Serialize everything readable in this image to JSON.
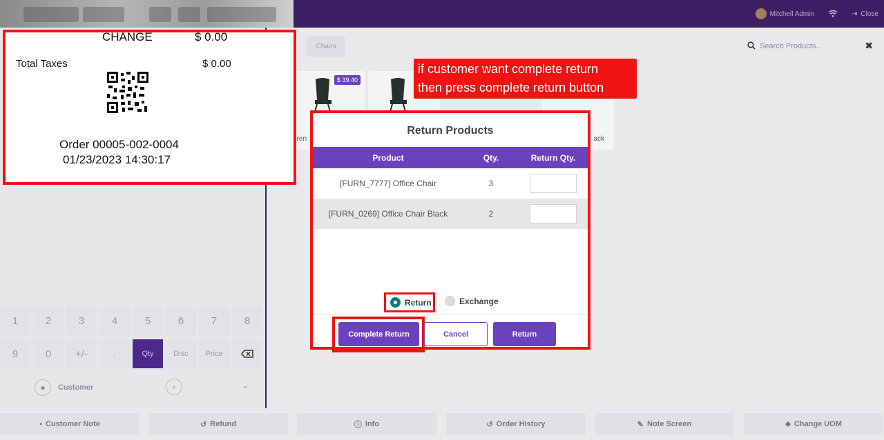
{
  "topbar": {
    "user_name": "Mitchell Admin",
    "close_label": "Close"
  },
  "products": {
    "category": "Chairs",
    "search_placeholder": "Search Products...",
    "cards": [
      {
        "price": "$ 39.40",
        "name": "eren"
      },
      {
        "price": "",
        "name": ""
      },
      {
        "price": "",
        "name": ""
      },
      {
        "price": "",
        "name": "ack"
      }
    ]
  },
  "receipt": {
    "change_label": "CHANGE",
    "change_value": "$ 0.00",
    "taxes_label": "Total Taxes",
    "taxes_value": "$ 0.00",
    "order_ref": "Order 00005-002-0004",
    "order_datetime": "01/23/2023 14:30:17"
  },
  "annotation": {
    "line1": "if  customer want complete return",
    "line2": "then press complete return button"
  },
  "modal": {
    "title": "Return Products",
    "columns": [
      "Product",
      "Qty.",
      "Return Qty."
    ],
    "rows": [
      {
        "product": "[FURN_7777] Office Chair",
        "qty": "3",
        "return_qty": ""
      },
      {
        "product": "[FURN_0269] Office Chair Black",
        "qty": "2",
        "return_qty": ""
      }
    ],
    "radio_return": "Return",
    "radio_exchange": "Exchange",
    "complete_return_label": "Complete Return",
    "cancel_label": "Cancel",
    "return_label": "Return"
  },
  "numpad": {
    "row1": [
      "1",
      "2",
      "3",
      "4",
      "5",
      "6",
      "7",
      "8"
    ],
    "row2": [
      "9",
      "0",
      "+/-",
      ".",
      "Qty",
      "Disc",
      "Price"
    ],
    "customer_label": "Customer"
  },
  "bottom_bar": [
    {
      "label": "Customer Note",
      "icon": "note-icon"
    },
    {
      "label": "Refund",
      "icon": "undo-icon"
    },
    {
      "label": "Info",
      "icon": "info-icon"
    },
    {
      "label": "Order History",
      "icon": "history-icon"
    },
    {
      "label": "Note Screen",
      "icon": "edit-icon"
    },
    {
      "label": "Change UOM",
      "icon": "tag-icon"
    }
  ]
}
